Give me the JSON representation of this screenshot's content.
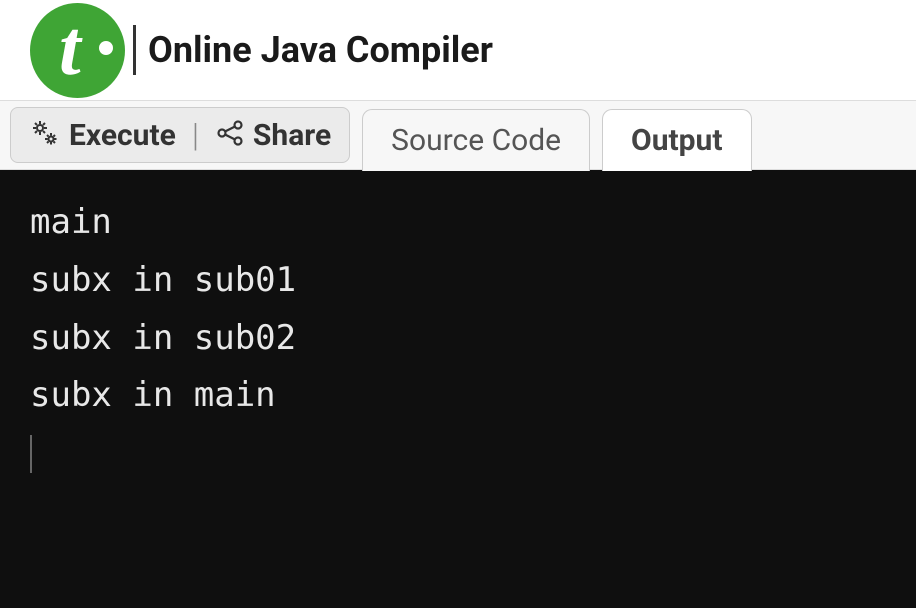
{
  "header": {
    "title": "Online Java Compiler"
  },
  "toolbar": {
    "execute_label": "Execute",
    "share_label": "Share"
  },
  "tabs": {
    "source_label": "Source Code",
    "output_label": "Output"
  },
  "output": {
    "lines": [
      "main",
      "subx in sub01",
      "subx in sub02",
      "subx in main"
    ]
  }
}
